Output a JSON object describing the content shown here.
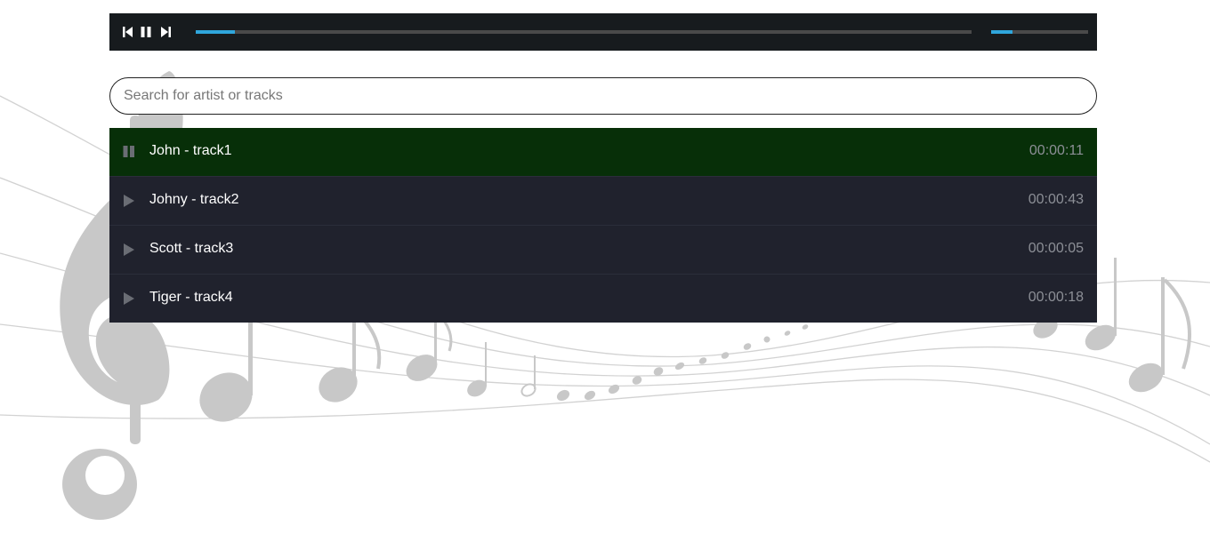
{
  "player": {
    "controls": [
      {
        "name": "previous-button",
        "icon": "skip-previous-icon"
      },
      {
        "name": "pause-button",
        "icon": "pause-icon"
      },
      {
        "name": "next-button",
        "icon": "skip-next-icon"
      }
    ],
    "progress_fraction": 0.05,
    "volume_fraction": 0.22,
    "accent_color": "#2fa6dc",
    "bar_color": "#171b1e"
  },
  "search": {
    "placeholder": "Search for artist or tracks",
    "value": ""
  },
  "tracks": [
    {
      "title": "John - track1",
      "duration": "00:00:11",
      "state": "playing",
      "icon": "pause-icon"
    },
    {
      "title": "Johny - track2",
      "duration": "00:00:43",
      "state": "idle",
      "icon": "play-icon"
    },
    {
      "title": "Scott - track3",
      "duration": "00:00:05",
      "state": "idle",
      "icon": "play-icon"
    },
    {
      "title": "Tiger - track4",
      "duration": "00:00:18",
      "state": "idle",
      "icon": "play-icon"
    }
  ],
  "colors": {
    "active_row": "#072f08",
    "row": "#20222d",
    "duration_text": "#8c8f96"
  },
  "background": {
    "image": "music-staff-treble-clef-notes-icon"
  }
}
